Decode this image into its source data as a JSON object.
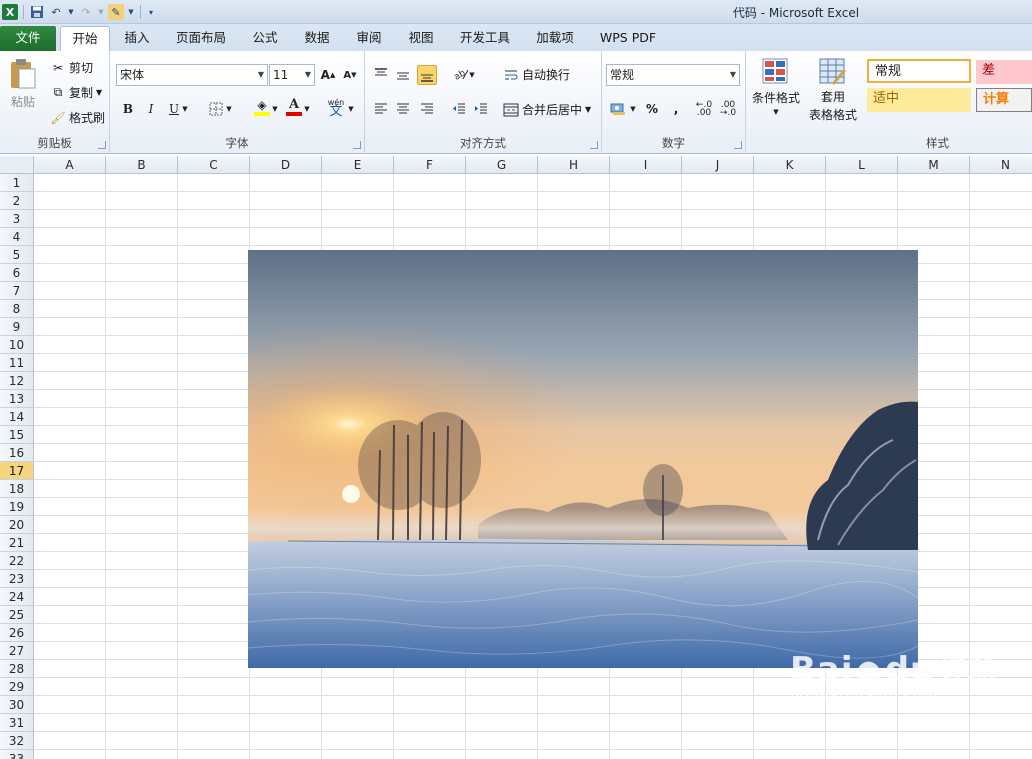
{
  "app": {
    "window_title": "代码  -  Microsoft Excel"
  },
  "tabs": {
    "file": "文件",
    "items": [
      "开始",
      "插入",
      "页面布局",
      "公式",
      "数据",
      "审阅",
      "视图",
      "开发工具",
      "加载项",
      "WPS PDF"
    ],
    "active": "开始"
  },
  "ribbon": {
    "clipboard": {
      "paste": "粘贴",
      "cut": "剪切",
      "copy": "复制",
      "format_painter": "格式刷",
      "label": "剪贴板"
    },
    "font": {
      "font_name": "宋体",
      "font_size": "11",
      "label": "字体"
    },
    "alignment": {
      "wrap_text": "自动换行",
      "merge_center": "合并后居中",
      "label": "对齐方式"
    },
    "number": {
      "format": "常规",
      "label": "数字"
    },
    "styles": {
      "conditional": "条件格式",
      "table_format_1": "套用",
      "table_format_2": "表格格式",
      "normal": "常规",
      "bad": "差",
      "neutral": "适中",
      "calculation": "计算",
      "label": "样式"
    }
  },
  "sheet": {
    "columns": [
      "A",
      "B",
      "C",
      "D",
      "E",
      "F",
      "G",
      "H",
      "I",
      "J",
      "K",
      "L",
      "M",
      "N"
    ],
    "rows": [
      "1",
      "2",
      "3",
      "4",
      "5",
      "6",
      "7",
      "8",
      "9",
      "10",
      "11",
      "12",
      "13",
      "14",
      "15",
      "16",
      "17",
      "18",
      "19",
      "20",
      "21",
      "22",
      "23",
      "24",
      "25",
      "26",
      "27",
      "28",
      "29",
      "30",
      "31",
      "32",
      "33"
    ],
    "selected_row": "17"
  },
  "watermark": {
    "brand": "Bai",
    "brand2": "du",
    "cn": "经验",
    "url": "jingyan.baidu.com"
  },
  "colors": {
    "file_tab": "#1f6d2d",
    "bad_style_bg": "#ffc7ce",
    "bad_style_text": "#9c0006",
    "neutral_style_bg": "#ffeb9c",
    "neutral_style_text": "#9c6500",
    "calc_style_bg": "#f2f2f2",
    "calc_style_text": "#fa7d00",
    "selected_row_header": "#f7d47e"
  }
}
